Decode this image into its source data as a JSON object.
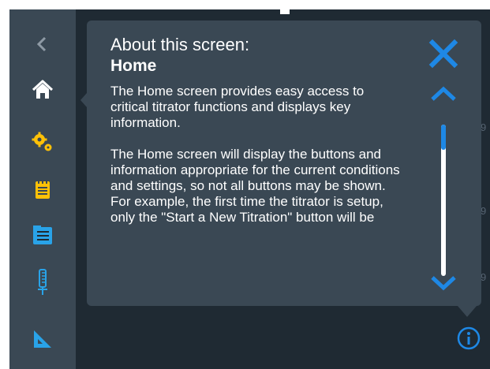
{
  "popup": {
    "title": "About this screen:",
    "heading": "Home",
    "paragraph1": "The Home screen provides easy access to critical titrator functions and displays key information.",
    "paragraph2": "The Home screen will display the buttons and information appropriate for the current conditions and settings, so not all buttons may be shown. For example, the first time the titrator is setup, only the \"Start a New Titration\" button will be",
    "close_icon": "close-icon",
    "scroll_up_icon": "chevron-up-icon",
    "scroll_down_icon": "chevron-down-icon",
    "scroll_position": 0.15
  },
  "sidebar": {
    "items": [
      {
        "name": "back",
        "icon": "chevron-left-icon"
      },
      {
        "name": "home",
        "icon": "home-icon",
        "active": true
      },
      {
        "name": "settings",
        "icon": "gears-icon"
      },
      {
        "name": "notes",
        "icon": "notepad-icon"
      },
      {
        "name": "records",
        "icon": "file-cabinet-icon"
      },
      {
        "name": "titrator",
        "icon": "burette-icon"
      },
      {
        "name": "calibration",
        "icon": "triangle-ruler-icon"
      }
    ]
  },
  "info_button": {
    "icon": "info-icon"
  },
  "colors": {
    "background": "#1f2a33",
    "panel": "#3a4854",
    "accent": "#1e88e5",
    "text": "#ffffff"
  }
}
